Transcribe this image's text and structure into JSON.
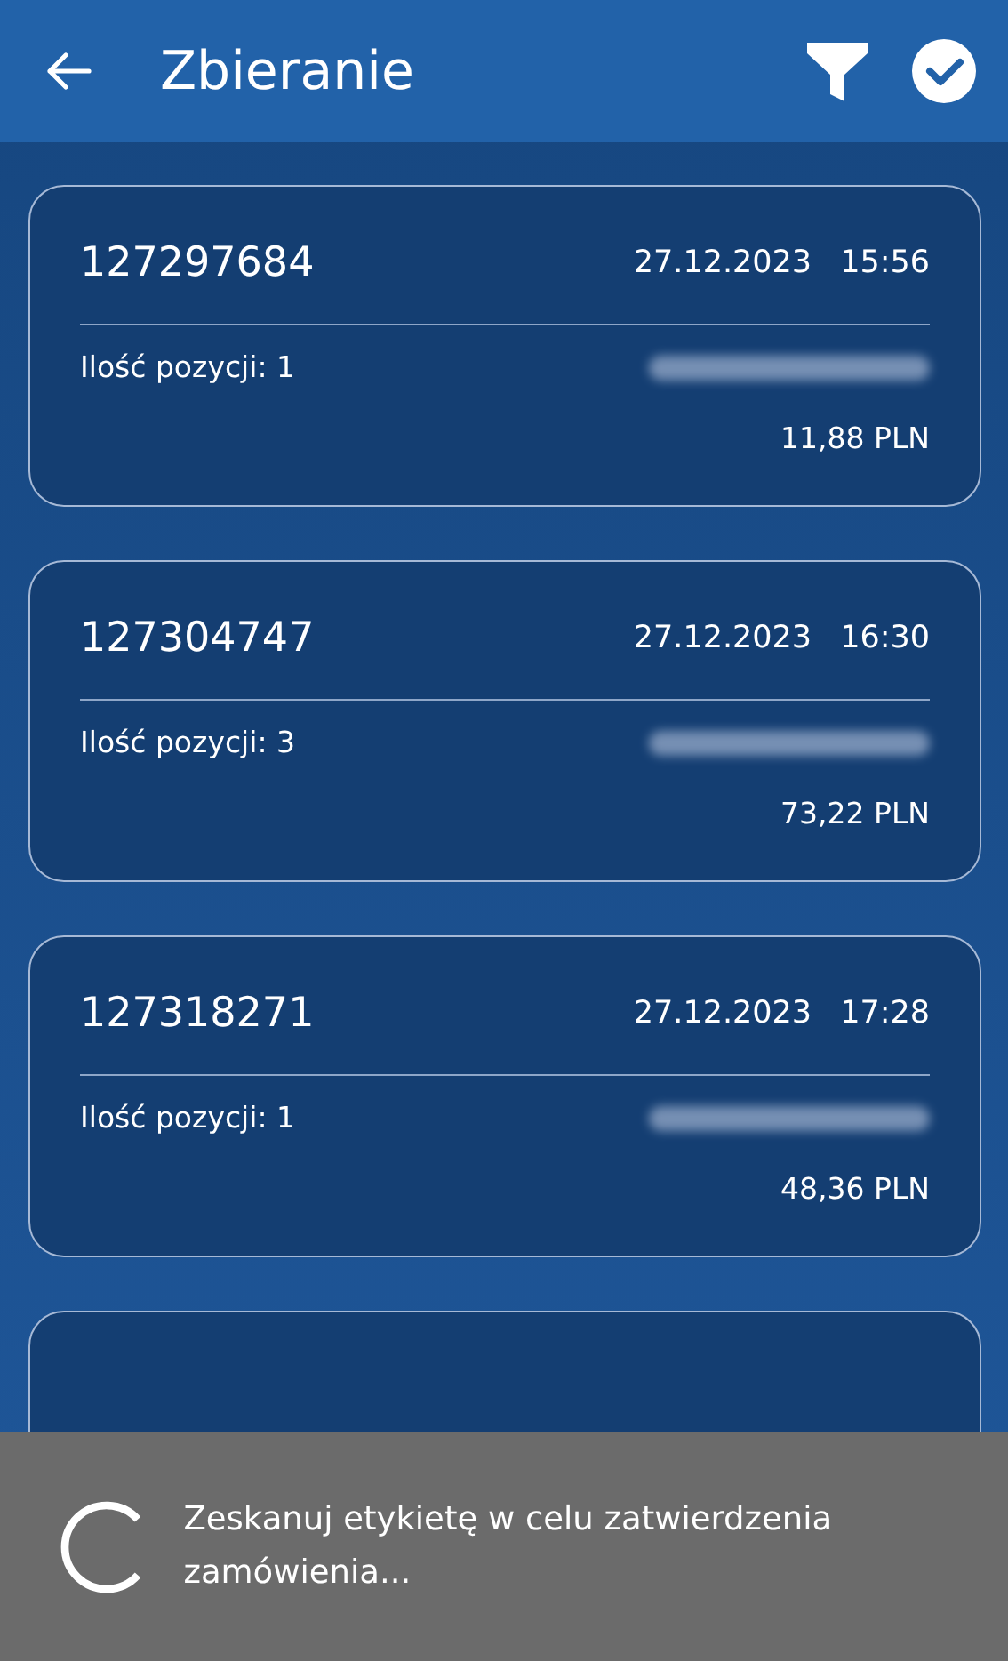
{
  "app_bar": {
    "title": "Zbieranie"
  },
  "orders": [
    {
      "number": "127297684",
      "date": "27.12.2023",
      "time": "15:56",
      "items_label": "Ilość pozycji: 1",
      "total": "11,88 PLN"
    },
    {
      "number": "127304747",
      "date": "27.12.2023",
      "time": "16:30",
      "items_label": "Ilość pozycji: 3",
      "total": "73,22 PLN"
    },
    {
      "number": "127318271",
      "date": "27.12.2023",
      "time": "17:28",
      "items_label": "Ilość pozycji: 1",
      "total": "48,36 PLN"
    }
  ],
  "snackbar": {
    "message": "Zeskanuj etykietę w celu zatwierdzenia zamówienia..."
  }
}
